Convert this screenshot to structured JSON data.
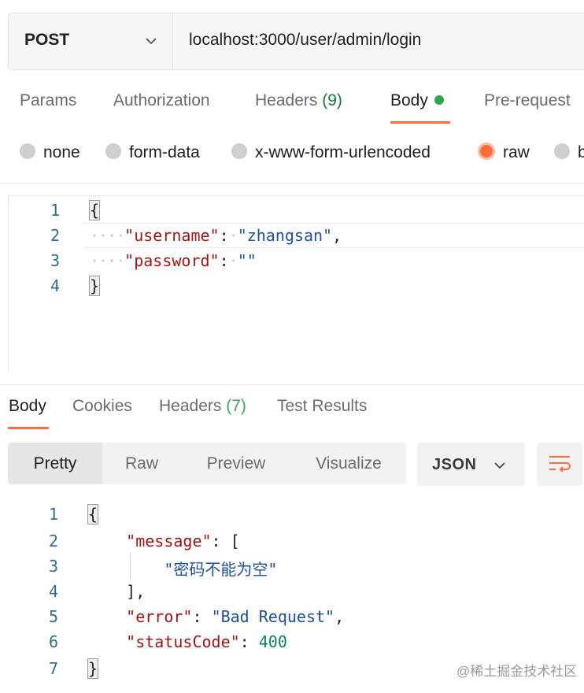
{
  "request": {
    "method": "POST",
    "url": "localhost:3000/user/admin/login"
  },
  "request_tabs": [
    {
      "label": "Params"
    },
    {
      "label": "Authorization"
    },
    {
      "label": "Headers",
      "count": "(9)"
    },
    {
      "label": "Body"
    },
    {
      "label": "Pre-request"
    }
  ],
  "body_types": [
    {
      "label": "none",
      "selected": false
    },
    {
      "label": "form-data",
      "selected": false
    },
    {
      "label": "x-www-form-urlencoded",
      "selected": false
    },
    {
      "label": "raw",
      "selected": true
    },
    {
      "label": "b",
      "selected": false
    }
  ],
  "request_body": {
    "line_numbers": [
      "1",
      "2",
      "3",
      "4"
    ],
    "open_brace": "{",
    "close_brace": "}",
    "username_key": "\"username\"",
    "username_value": "\"zhangsan\"",
    "password_key": "\"password\"",
    "password_value": "\"\""
  },
  "response_tabs": [
    {
      "label": "Body"
    },
    {
      "label": "Cookies"
    },
    {
      "label": "Headers",
      "count": "(7)"
    },
    {
      "label": "Test Results"
    }
  ],
  "view_modes": [
    "Pretty",
    "Raw",
    "Preview",
    "Visualize"
  ],
  "format": "JSON",
  "response_body": {
    "line_numbers": [
      "1",
      "2",
      "3",
      "4",
      "5",
      "6",
      "7"
    ],
    "open_brace": "{",
    "close_brace": "}",
    "message_key": "\"message\"",
    "message_value": "\"密码不能为空\"",
    "error_key": "\"error\"",
    "error_value": "\"Bad Request\"",
    "status_key": "\"statusCode\"",
    "status_value": "400"
  },
  "watermark": "@稀土掘金技术社区",
  "colors": {
    "accent": "#ff6c37",
    "active_dot": "#2ba84a",
    "json_key": "#a31515",
    "json_string": "#1e50a0",
    "json_number": "#098658"
  },
  "icons": [
    "chevron-down-icon",
    "wrap-lines-icon"
  ]
}
